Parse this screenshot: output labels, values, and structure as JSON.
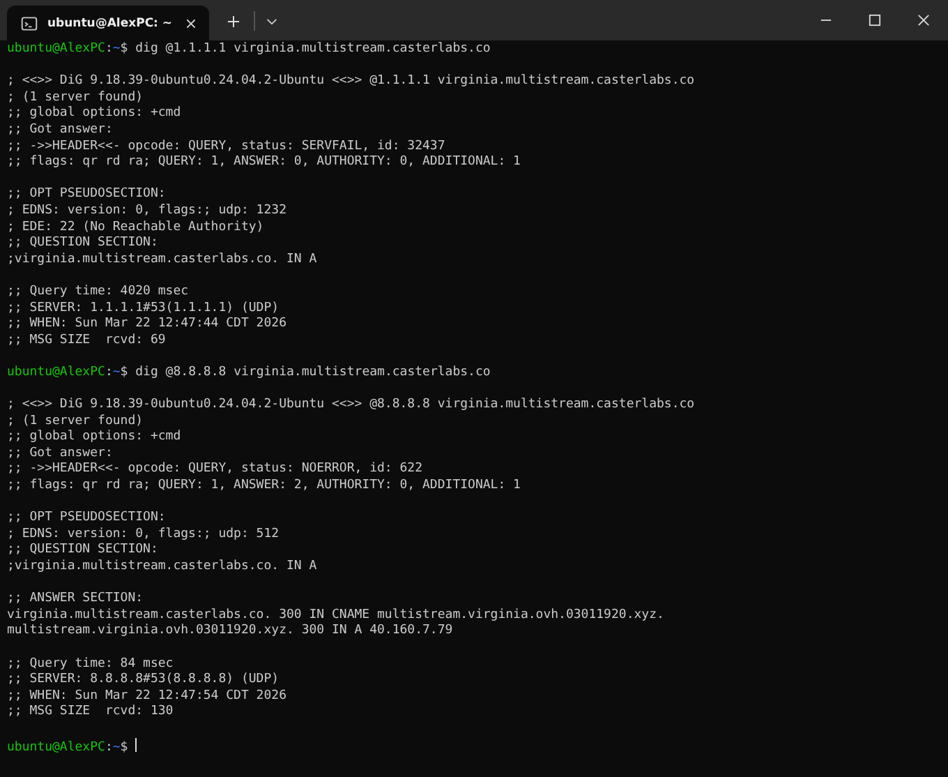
{
  "tabs": [
    {
      "title": "ubuntu@AlexPC: ~",
      "selected": true
    }
  ],
  "terminal": {
    "lines": [
      {
        "kind": "prompt",
        "user": "ubuntu@AlexPC",
        "sep": ":",
        "path": "~",
        "command": "$ dig @1.1.1.1 virginia.multistream.casterlabs.co"
      },
      {
        "kind": "blank"
      },
      {
        "kind": "output",
        "text": "; <<>> DiG 9.18.39-0ubuntu0.24.04.2-Ubuntu <<>> @1.1.1.1 virginia.multistream.casterlabs.co"
      },
      {
        "kind": "output",
        "text": "; (1 server found)"
      },
      {
        "kind": "output",
        "text": ";; global options: +cmd"
      },
      {
        "kind": "output",
        "text": ";; Got answer:"
      },
      {
        "kind": "output",
        "text": ";; ->>HEADER<<- opcode: QUERY, status: SERVFAIL, id: 32437"
      },
      {
        "kind": "output",
        "text": ";; flags: qr rd ra; QUERY: 1, ANSWER: 0, AUTHORITY: 0, ADDITIONAL: 1"
      },
      {
        "kind": "blank"
      },
      {
        "kind": "output",
        "text": ";; OPT PSEUDOSECTION:"
      },
      {
        "kind": "output",
        "text": "; EDNS: version: 0, flags:; udp: 1232"
      },
      {
        "kind": "output",
        "text": "; EDE: 22 (No Reachable Authority)"
      },
      {
        "kind": "output",
        "text": ";; QUESTION SECTION:"
      },
      {
        "kind": "output",
        "text": ";virginia.multistream.casterlabs.co. IN A"
      },
      {
        "kind": "blank"
      },
      {
        "kind": "output",
        "text": ";; Query time: 4020 msec"
      },
      {
        "kind": "output",
        "text": ";; SERVER: 1.1.1.1#53(1.1.1.1) (UDP)"
      },
      {
        "kind": "output",
        "text": ";; WHEN: Sun Mar 22 12:47:44 CDT 2026"
      },
      {
        "kind": "output",
        "text": ";; MSG SIZE  rcvd: 69"
      },
      {
        "kind": "blank"
      },
      {
        "kind": "prompt",
        "user": "ubuntu@AlexPC",
        "sep": ":",
        "path": "~",
        "command": "$ dig @8.8.8.8 virginia.multistream.casterlabs.co"
      },
      {
        "kind": "blank"
      },
      {
        "kind": "output",
        "text": "; <<>> DiG 9.18.39-0ubuntu0.24.04.2-Ubuntu <<>> @8.8.8.8 virginia.multistream.casterlabs.co"
      },
      {
        "kind": "output",
        "text": "; (1 server found)"
      },
      {
        "kind": "output",
        "text": ";; global options: +cmd"
      },
      {
        "kind": "output",
        "text": ";; Got answer:"
      },
      {
        "kind": "output",
        "text": ";; ->>HEADER<<- opcode: QUERY, status: NOERROR, id: 622"
      },
      {
        "kind": "output",
        "text": ";; flags: qr rd ra; QUERY: 1, ANSWER: 2, AUTHORITY: 0, ADDITIONAL: 1"
      },
      {
        "kind": "blank"
      },
      {
        "kind": "output",
        "text": ";; OPT PSEUDOSECTION:"
      },
      {
        "kind": "output",
        "text": "; EDNS: version: 0, flags:; udp: 512"
      },
      {
        "kind": "output",
        "text": ";; QUESTION SECTION:"
      },
      {
        "kind": "output",
        "text": ";virginia.multistream.casterlabs.co. IN A"
      },
      {
        "kind": "blank"
      },
      {
        "kind": "output",
        "text": ";; ANSWER SECTION:"
      },
      {
        "kind": "output",
        "text": "virginia.multistream.casterlabs.co. 300 IN CNAME multistream.virginia.ovh.03011920.xyz."
      },
      {
        "kind": "output",
        "text": "multistream.virginia.ovh.03011920.xyz. 300 IN A 40.160.7.79"
      },
      {
        "kind": "blank"
      },
      {
        "kind": "output",
        "text": ";; Query time: 84 msec"
      },
      {
        "kind": "output",
        "text": ";; SERVER: 8.8.8.8#53(8.8.8.8) (UDP)"
      },
      {
        "kind": "output",
        "text": ";; WHEN: Sun Mar 22 12:47:54 CDT 2026"
      },
      {
        "kind": "output",
        "text": ";; MSG SIZE  rcvd: 130"
      },
      {
        "kind": "blank"
      },
      {
        "kind": "prompt",
        "user": "ubuntu@AlexPC",
        "sep": ":",
        "path": "~",
        "command": "$",
        "cursor": true
      }
    ]
  }
}
